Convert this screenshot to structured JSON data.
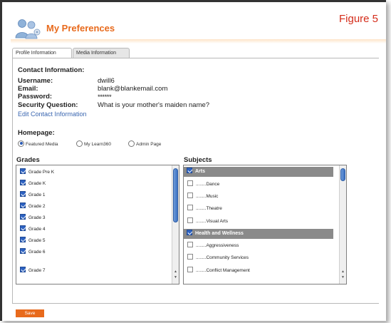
{
  "figure_label": "Figure 5",
  "page_title": "My Preferences",
  "tabs": [
    {
      "label": "Profile Information",
      "active": true
    },
    {
      "label": "Media Information",
      "active": false
    }
  ],
  "contact": {
    "heading": "Contact Information:",
    "username_label": "Username:",
    "username_value": "dwill6",
    "email_label": "Email:",
    "email_value": "blank@blankemail.com",
    "password_label": "Password:",
    "password_value": "******",
    "security_label": "Security Question:",
    "security_value": "What is your mother's maiden name?",
    "edit_link": "Edit Contact Information"
  },
  "homepage": {
    "heading": "Homepage:",
    "options": [
      {
        "label": "Featured Media",
        "selected": true
      },
      {
        "label": "My Learn360",
        "selected": false
      },
      {
        "label": "Admin Page",
        "selected": false
      }
    ]
  },
  "grades": {
    "heading": "Grades",
    "items": [
      {
        "label": "Grade Pre K",
        "checked": true
      },
      {
        "label": "Grade K",
        "checked": true
      },
      {
        "label": "Grade 1",
        "checked": true
      },
      {
        "label": "Grade 2",
        "checked": true
      },
      {
        "label": "Grade 3",
        "checked": true
      },
      {
        "label": "Grade 4",
        "checked": true
      },
      {
        "label": "Grade 5",
        "checked": true
      },
      {
        "label": "Grade 6",
        "checked": true
      },
      {
        "label": "Grade 7",
        "checked": true
      }
    ]
  },
  "subjects": {
    "heading": "Subjects",
    "items": [
      {
        "label": "Arts",
        "checked": true,
        "category": true
      },
      {
        "label": "........Dance",
        "checked": false,
        "category": false
      },
      {
        "label": "........Music",
        "checked": false,
        "category": false
      },
      {
        "label": "........Theatre",
        "checked": false,
        "category": false
      },
      {
        "label": "........Visual Arts",
        "checked": false,
        "category": false
      },
      {
        "label": "Health and Wellness",
        "checked": true,
        "category": true
      },
      {
        "label": "........Aggressiveness",
        "checked": false,
        "category": false
      },
      {
        "label": "........Community Services",
        "checked": false,
        "category": false
      },
      {
        "label": "........Conflict Management",
        "checked": false,
        "category": false
      }
    ]
  },
  "save_label": "Save",
  "colors": {
    "accent": "#e86a1c",
    "figure_label": "#d42c1a",
    "link": "#3a66b0",
    "checkbox": "#2d62c2"
  }
}
